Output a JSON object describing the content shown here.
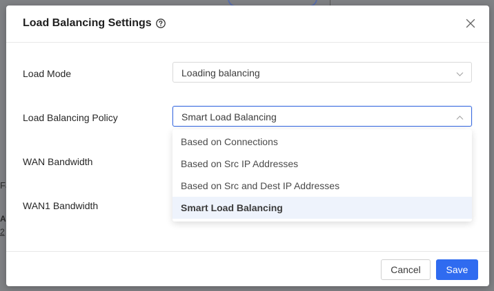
{
  "background": {
    "fragments": [
      "Fa",
      "A",
      "2"
    ]
  },
  "modal": {
    "title": "Load Balancing Settings",
    "help_icon": "question-circle-icon",
    "close_icon": "close-icon"
  },
  "form": {
    "load_mode": {
      "label": "Load Mode",
      "value": "Loading balancing"
    },
    "load_balancing_policy": {
      "label": "Load Balancing Policy",
      "value": "Smart Load Balancing",
      "options": [
        "Based on Connections",
        "Based on Src IP Addresses",
        "Based on Src and Dest IP Addresses",
        "Smart Load Balancing"
      ]
    },
    "wan_bandwidth": {
      "label": "WAN Bandwidth"
    },
    "wan1_bandwidth": {
      "label": "WAN1 Bandwidth"
    }
  },
  "footer": {
    "cancel_label": "Cancel",
    "save_label": "Save"
  },
  "colors": {
    "primary": "#2f6bf0",
    "focus_border": "#3a6bdf",
    "selected_option_bg": "#eef3fc"
  }
}
